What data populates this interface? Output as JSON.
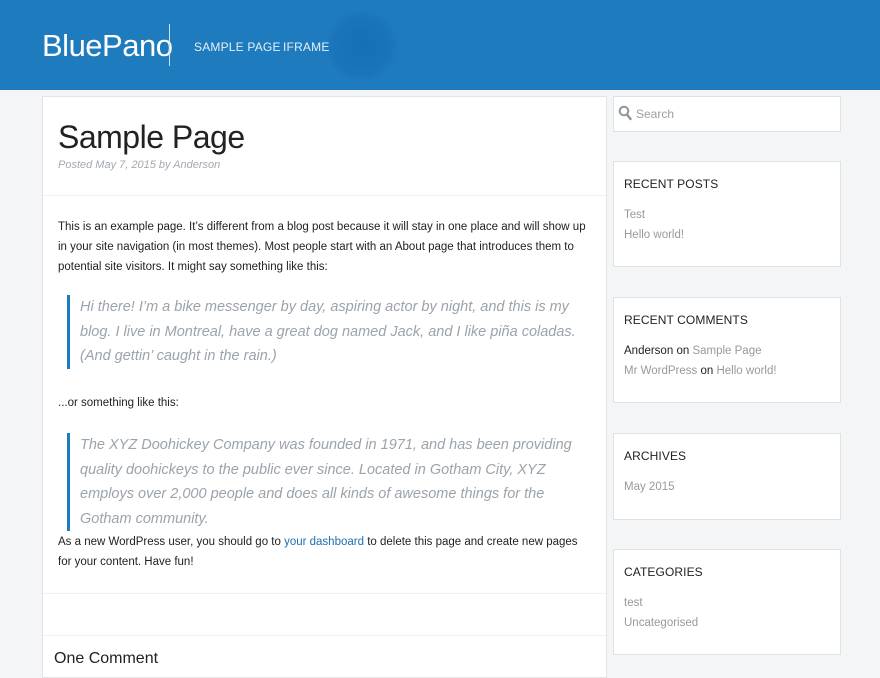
{
  "site": {
    "title": "BluePano"
  },
  "nav": {
    "items": [
      {
        "label": "Sample Page"
      },
      {
        "label": "iFrame"
      }
    ]
  },
  "post": {
    "title": "Sample Page",
    "meta": "Posted May 7, 2015 by Anderson",
    "p1": "This is an example page. It’s different from a blog post because it will stay in one place and will show up in your site navigation (in most themes). Most people start with an About page that introduces them to potential site visitors. It might say something like this:",
    "quote1": "Hi there! I’m a bike messenger by day, aspiring actor by night, and this is my blog. I live in Montreal, have a great dog named Jack, and I like piña coladas. (And gettin’ caught in the rain.)",
    "p2": "...or something like this:",
    "quote2": "The XYZ Doohickey Company was founded in 1971, and has been providing quality doohickeys to the public ever since. Located in Gotham City, XYZ employs over 2,000 people and does all kinds of awesome things for the Gotham community.",
    "p3_before": "As a new WordPress user, you should go to ",
    "p3_link": "your dashboard",
    "p3_after": " to delete this page and create new pages for your content. Have fun!",
    "comments_title": "One Comment"
  },
  "search": {
    "placeholder": "Search"
  },
  "widgets": {
    "recent_posts": {
      "title": "Recent Posts",
      "items": [
        "Test",
        "Hello world!"
      ]
    },
    "recent_comments": {
      "title": "Recent Comments",
      "items": [
        {
          "author": "Anderson",
          "on": "on",
          "target": "Sample Page"
        },
        {
          "author": "Mr WordPress",
          "on": "on",
          "target": "Hello world!"
        }
      ]
    },
    "archives": {
      "title": "Archives",
      "items": [
        "May 2015"
      ]
    },
    "categories": {
      "title": "Categories",
      "items": [
        "test",
        "Uncategorised"
      ]
    }
  },
  "colors": {
    "header": "#1e7bbd",
    "accent": "#1e6fb0",
    "quote_border": "#1e7bbd"
  }
}
